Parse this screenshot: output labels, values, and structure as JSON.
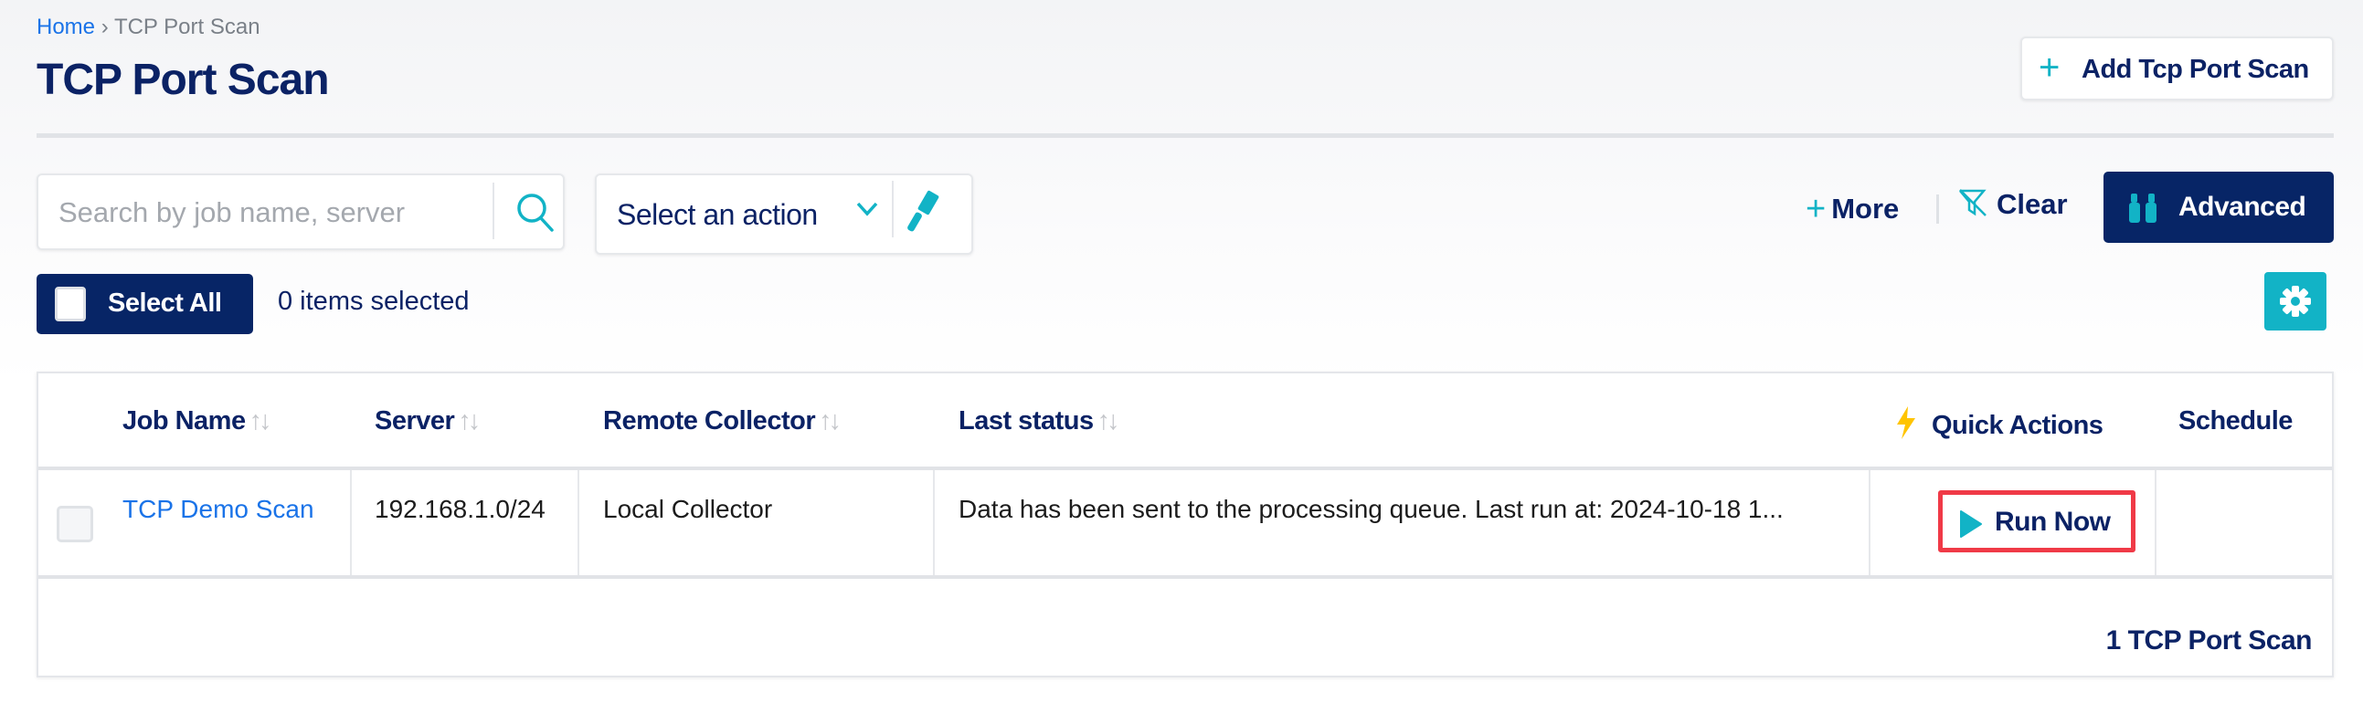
{
  "breadcrumb": {
    "home": "Home",
    "separator": "›",
    "current": "TCP Port Scan"
  },
  "page_title": "TCP Port Scan",
  "header": {
    "add_button": "Add Tcp Port Scan"
  },
  "toolbar": {
    "search_placeholder": "Search by job name, server",
    "action_select": "Select an action",
    "more": "More",
    "clear": "Clear",
    "advanced": "Advanced",
    "select_all": "Select All",
    "selected_count": "0 items selected"
  },
  "colors": {
    "navy": "#072566",
    "teal": "#12b3c6",
    "link": "#1a73e8",
    "highlight": "#f03a47",
    "bolt": "#ffc400"
  },
  "table": {
    "columns": [
      "Job Name",
      "Server",
      "Remote Collector",
      "Last status",
      "Quick Actions",
      "Schedule"
    ],
    "rows": [
      {
        "job_name": "TCP Demo Scan",
        "server": "192.168.1.0/24",
        "remote_collector": "Local Collector",
        "last_status": "Data has been sent to the processing queue. Last run at: 2024-10-18 1...",
        "quick_action": "Run Now",
        "schedule": ""
      }
    ],
    "footer": "1 TCP Port Scan"
  }
}
